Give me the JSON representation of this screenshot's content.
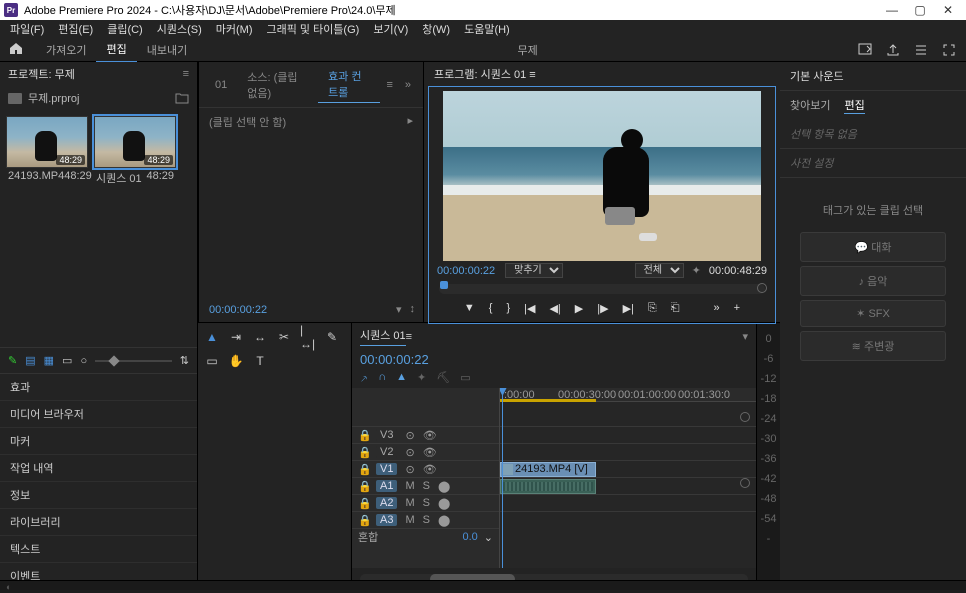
{
  "titlebar": {
    "app_icon_text": "Pr",
    "title": "Adobe Premiere Pro 2024 - C:\\사용자\\DJ\\문서\\Adobe\\Premiere Pro\\24.0\\무제"
  },
  "menubar": [
    "파일(F)",
    "편집(E)",
    "클립(C)",
    "시퀀스(S)",
    "마커(M)",
    "그래픽 및 타이틀(G)",
    "보기(V)",
    "창(W)",
    "도움말(H)"
  ],
  "workspace": {
    "tabs": [
      "가져오기",
      "편집",
      "내보내기"
    ],
    "active_index": 1,
    "center_title": "무제"
  },
  "project": {
    "panel_label": "프로젝트: 무제",
    "breadcrumb_file": "무제.prproj",
    "bins": [
      {
        "name": "24193.MP4",
        "dur": "48:29",
        "is_sequence": false
      },
      {
        "name": "시퀀스 01",
        "dur": "48:29",
        "is_sequence": true
      }
    ],
    "side_panels": [
      "효과",
      "미디어 브라우저",
      "마커",
      "작업 내역",
      "정보",
      "라이브러리",
      "텍스트",
      "이벤트"
    ]
  },
  "source": {
    "tabs": [
      {
        "label": "01",
        "active": false
      },
      {
        "label": "소스: (클립 없음)",
        "active": false
      },
      {
        "label": "효과 컨트롤",
        "active": true
      }
    ],
    "body_text": "(클립 선택 안 함)",
    "tc": "00:00:00:22"
  },
  "program": {
    "panel_label": "프로그램: 시퀀스 01",
    "tc_current": "00:00:00:22",
    "fit_label": "맞추기",
    "view_label": "전체",
    "tc_total": "00:00:48:29"
  },
  "timeline": {
    "tab_label": "시퀀스 01",
    "tc": "00:00:00:22",
    "ruler": [
      ":00:00",
      "00:00:30:00",
      "00:01:00:00",
      "00:01:30:0"
    ],
    "tracks_video": [
      "V3",
      "V2",
      "V1"
    ],
    "tracks_audio": [
      "A1",
      "A2",
      "A3"
    ],
    "active_video": "V1",
    "active_audio": [
      "A1",
      "A2",
      "A3"
    ],
    "clip_label": "24193.MP4 [V]",
    "mix_label": "혼합",
    "mix_value": "0.0"
  },
  "audiometer": [
    "0",
    "-6",
    "-12",
    "-18",
    "-24",
    "-30",
    "-36",
    "-42",
    "-48",
    "-54",
    "-"
  ],
  "essential_sound": {
    "panel_label": "기본 사운드",
    "tabs": [
      "찾아보기",
      "편집"
    ],
    "active": 1,
    "no_sel": "선택 항목 없음",
    "preset_label": "사전 설정",
    "msg": "태그가 있는 클립 선택",
    "buttons": [
      {
        "icon": "dialogue-icon",
        "label": "대화"
      },
      {
        "icon": "music-icon",
        "label": "음악"
      },
      {
        "icon": "sfx-icon",
        "label": "SFX"
      },
      {
        "icon": "ambience-icon",
        "label": "주변광"
      }
    ]
  }
}
